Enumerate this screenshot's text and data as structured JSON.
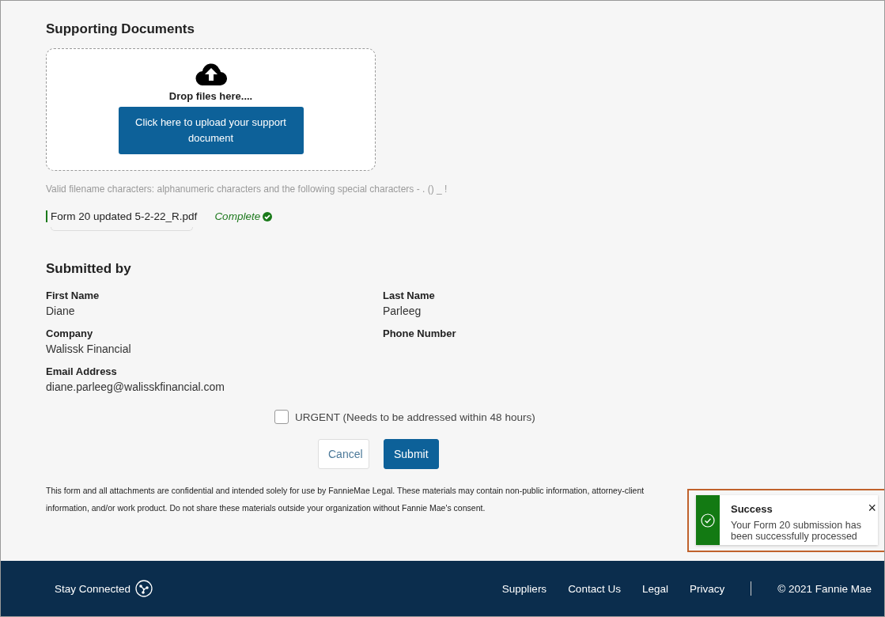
{
  "supporting_documents": {
    "title": "Supporting Documents",
    "drop_text": "Drop files here....",
    "upload_button": "Click here to upload your support document",
    "hint": "Valid filename characters: alphanumeric characters and the following special characters - . () _ !",
    "files": [
      {
        "name": "Form 20 updated 5-2-22_R.pdf",
        "status": "Complete",
        "complete": true
      }
    ]
  },
  "submitted_by": {
    "title": "Submitted by",
    "fields": [
      {
        "label": "First Name",
        "value": "Diane"
      },
      {
        "label": "Last Name",
        "value": "Parleeg"
      },
      {
        "label": "Company",
        "value": "Walissk Financial"
      },
      {
        "label": "Phone Number"
      },
      {
        "label": "Email Address",
        "value": "diane.parleeg@walisskfinancial.com"
      }
    ]
  },
  "urgent": {
    "label": "URGENT (Needs to be addressed within 48 hours)",
    "checked": false
  },
  "buttons": [
    {
      "label": "Cancel",
      "kind": "secondary"
    },
    {
      "label": "Submit",
      "kind": "primary"
    }
  ],
  "disclaimer": "This form and all attachments are confidential and intended solely for use by FannieMae Legal. These materials may contain non-public information, attorney-client information, and/or work product. Do not share these materials outside your organization without Fannie Mae's consent.",
  "footer": {
    "stay_connected": "Stay Connected",
    "links": [
      "Suppliers",
      "Contact Us",
      "Legal",
      "Privacy"
    ],
    "copyright": "© 2021 Fannie Mae"
  },
  "toast": {
    "title": "Success",
    "message": "Your Form 20 submission has been successfully processed",
    "close": "×"
  }
}
